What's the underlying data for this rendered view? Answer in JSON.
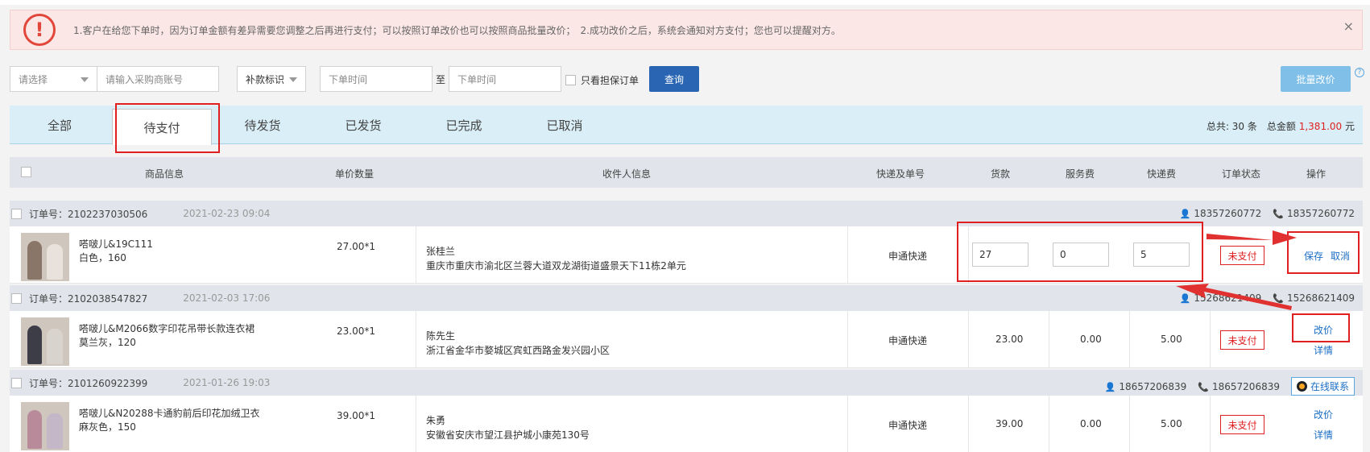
{
  "notice": {
    "text": "1.客户在给您下单时，因为订单金额有差异需要您调整之后再进行支付；可以按照订单改价也可以按照商品批量改价；　2.成功改价之后，系统会通知对方支付；您也可以提醒对方。",
    "warn_glyph": "!",
    "close_glyph": "×"
  },
  "filters": {
    "select1": "请选择",
    "buyer_placeholder": "请输入采购商账号",
    "supplement": "补款标识",
    "start_placeholder": "下单时间",
    "to": "至",
    "end_placeholder": "下单时间",
    "guard_label": "只看担保订单",
    "query_label": "查询",
    "batch_label": "批量改价",
    "help_glyph": "?"
  },
  "tabs": [
    {
      "label": "全部"
    },
    {
      "label": "待支付"
    },
    {
      "label": "待发货"
    },
    {
      "label": "已发货"
    },
    {
      "label": "已完成"
    },
    {
      "label": "已取消"
    }
  ],
  "totals": {
    "prefix": "总共: 30 条　总金额",
    "amount": "1,381.00",
    "unit": "元"
  },
  "table_header": [
    "商品信息",
    "单价数量",
    "收件人信息",
    "快递及单号",
    "货款",
    "服务费",
    "快递费",
    "订单状态",
    "操作"
  ],
  "orders": [
    {
      "order_no": "订单号：2102237030506",
      "time": "2021-02-23 09:04",
      "account": "18357260772",
      "phone": "18357260772",
      "product_name": "嗒啵儿&19C111",
      "product_spec": "白色，160",
      "price_qty": "27.00*1",
      "recipient": "张桂兰",
      "address": "重庆市重庆市渝北区兰蓉大道双龙湖街道盛景天下11栋2单元",
      "express": "申通快递",
      "goods_input": "27",
      "service_input": "0",
      "shipping_input": "5",
      "status": "未支付",
      "op1": "保存",
      "op2": "取消"
    },
    {
      "order_no": "订单号：2102038547827",
      "time": "2021-02-03 17:06",
      "account": "15268621409",
      "phone": "15268621409",
      "product_name": "嗒啵儿&M2066数字印花吊带长款连衣裙",
      "product_spec": "莫兰灰，120",
      "price_qty": "23.00*1",
      "recipient": "陈先生",
      "address": "浙江省金华市婺城区宾虹西路金发兴园小区",
      "express": "申通快递",
      "goods": "23.00",
      "service": "0.00",
      "shipping": "5.00",
      "status": "未支付",
      "op1": "改价",
      "op2": "详情"
    },
    {
      "order_no": "订单号：2101260922399",
      "time": "2021-01-26 19:03",
      "account": "18657206839",
      "phone": "18657206839",
      "online_contact": "在线联系",
      "product_name": "嗒啵儿&N20288卡通豹前后印花加绒卫衣",
      "product_spec": "麻灰色，150",
      "price_qty": "39.00*1",
      "recipient": "朱勇",
      "address": "安徽省安庆市望江县护城小康苑130号",
      "express": "申通快递",
      "goods": "39.00",
      "service": "0.00",
      "shipping": "5.00",
      "status": "未支付",
      "op1": "改价",
      "op2": "详情"
    }
  ]
}
